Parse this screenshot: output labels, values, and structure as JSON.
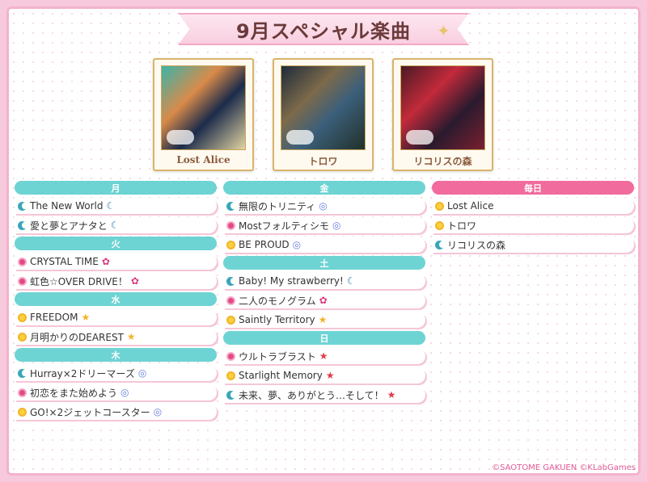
{
  "title": "9月スペシャル楽曲",
  "albums": [
    {
      "name": "Lost Alice"
    },
    {
      "name": "トロワ"
    },
    {
      "name": "リコリスの森"
    }
  ],
  "schedule": {
    "col1": [
      {
        "day": "月",
        "songs": [
          {
            "title": "The New World",
            "icon": "moon-icon",
            "trail": "☾",
            "trail_icon": "moon-icon"
          },
          {
            "title": "愛と夢とアナタと",
            "icon": "moon-icon",
            "trail": "☾",
            "trail_icon": "moon-icon"
          }
        ]
      },
      {
        "day": "火",
        "songs": [
          {
            "title": "CRYSTAL TIME",
            "icon": "flower-icon",
            "trail": "✿",
            "trail_icon": "gear-icon"
          },
          {
            "title": "虹色☆OVER DRIVE！",
            "icon": "flower-icon",
            "trail": "✿",
            "trail_icon": "gear-icon"
          }
        ]
      },
      {
        "day": "水",
        "songs": [
          {
            "title": "FREEDOM",
            "icon": "sun-icon",
            "trail": "★",
            "trail_icon": "star-icon"
          },
          {
            "title": "月明かりのDEAREST",
            "icon": "sun-icon",
            "trail": "★",
            "trail_icon": "star-icon"
          }
        ]
      },
      {
        "day": "木",
        "songs": [
          {
            "title": "Hurray×2ドリーマーズ",
            "icon": "moon-icon",
            "trail": "◎",
            "trail_icon": "orb-icon"
          },
          {
            "title": "初恋をまた始めよう",
            "icon": "flower-icon",
            "trail": "◎",
            "trail_icon": "orb-icon"
          },
          {
            "title": "GO!×2ジェットコースター",
            "icon": "sun-icon",
            "trail": "◎",
            "trail_icon": "orb-icon"
          }
        ]
      }
    ],
    "col2": [
      {
        "day": "金",
        "songs": [
          {
            "title": "無限のトリニティ",
            "icon": "moon-icon",
            "trail": "◎",
            "trail_icon": "orb-icon"
          },
          {
            "title": "Mostフォルティシモ",
            "icon": "flower-icon",
            "trail": "◎",
            "trail_icon": "orb-icon"
          },
          {
            "title": "BE PROUD",
            "icon": "sun-icon",
            "trail": "◎",
            "trail_icon": "orb-icon"
          }
        ]
      },
      {
        "day": "土",
        "songs": [
          {
            "title": "Baby! My strawberry!",
            "icon": "moon-icon",
            "trail": "☾",
            "trail_icon": "moon-icon"
          },
          {
            "title": "二人のモノグラム",
            "icon": "flower-icon",
            "trail": "✿",
            "trail_icon": "gear-icon"
          },
          {
            "title": "Saintly Territory",
            "icon": "sun-icon",
            "trail": "★",
            "trail_icon": "star-icon"
          }
        ]
      },
      {
        "day": "日",
        "songs": [
          {
            "title": "ウルトラブラスト",
            "icon": "flower-icon",
            "trail": "★",
            "trail_icon": "red-star-icon"
          },
          {
            "title": "Starlight Memory",
            "icon": "sun-icon",
            "trail": "★",
            "trail_icon": "red-star-icon"
          },
          {
            "title": "未来、夢、ありがとう…そして！",
            "icon": "moon-icon",
            "trail": "★",
            "trail_icon": "red-star-icon"
          }
        ]
      }
    ],
    "col3": [
      {
        "day": "毎日",
        "songs": [
          {
            "title": "Lost Alice",
            "icon": "sun-icon",
            "trail": "",
            "trail_icon": ""
          },
          {
            "title": "トロワ",
            "icon": "sun-icon",
            "trail": "",
            "trail_icon": ""
          },
          {
            "title": "リコリスの森",
            "icon": "moon-icon",
            "trail": "",
            "trail_icon": ""
          }
        ]
      }
    ]
  },
  "copyright": "©SAOTOME GAKUEN ©KLabGames",
  "colors": {
    "accent_teal": "#6ed3d3",
    "accent_pink": "#f16b9c",
    "frame": "#f7c9dc"
  }
}
